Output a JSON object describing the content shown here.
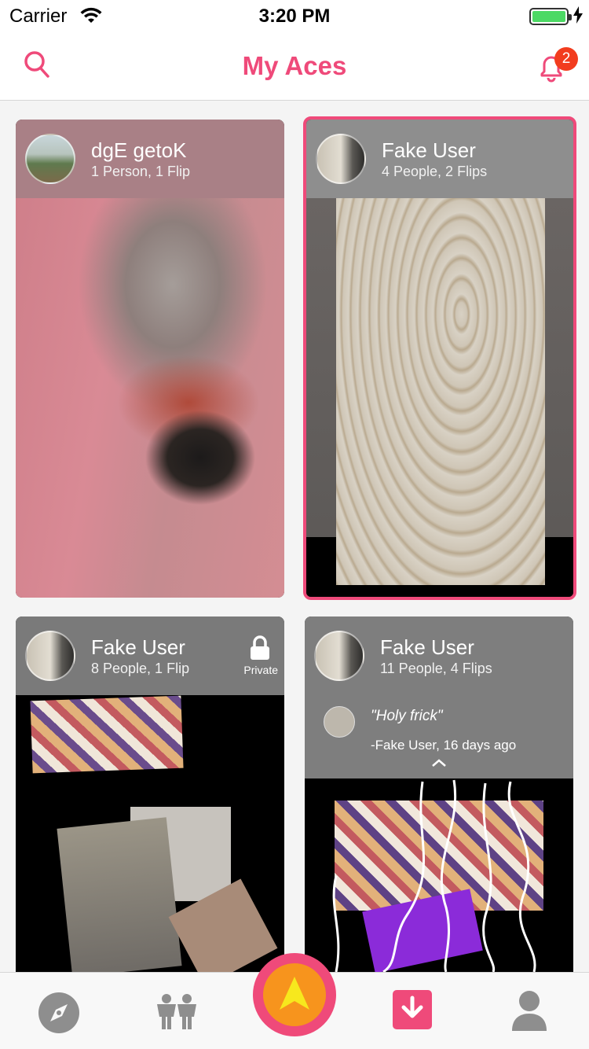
{
  "status_bar": {
    "carrier": "Carrier",
    "time": "3:20 PM"
  },
  "nav": {
    "title": "My Aces",
    "notification_count": "2"
  },
  "cards": [
    {
      "name": "dgE getoK",
      "meta": "1 Person, 1 Flip"
    },
    {
      "name": "Fake User",
      "meta": "4 People, 2 Flips"
    },
    {
      "name": "Fake User",
      "meta": "8 People, 1 Flip",
      "lock_label": "Private"
    },
    {
      "name": "Fake User",
      "meta": "11 People, 4 Flips",
      "comment": {
        "quote": "\"Holy frick\"",
        "byline": "-Fake User, 16 days ago"
      }
    }
  ],
  "tabs": [
    {
      "icon": "compass-icon"
    },
    {
      "icon": "people-icon"
    },
    {
      "icon": "ace-arrow-icon"
    },
    {
      "icon": "download-box-icon"
    },
    {
      "icon": "profile-icon"
    }
  ],
  "colors": {
    "accent": "#ef4a7a",
    "badge": "#f23c1e",
    "center_inner": "#f7941d",
    "center_arrow": "#f7e81d"
  }
}
